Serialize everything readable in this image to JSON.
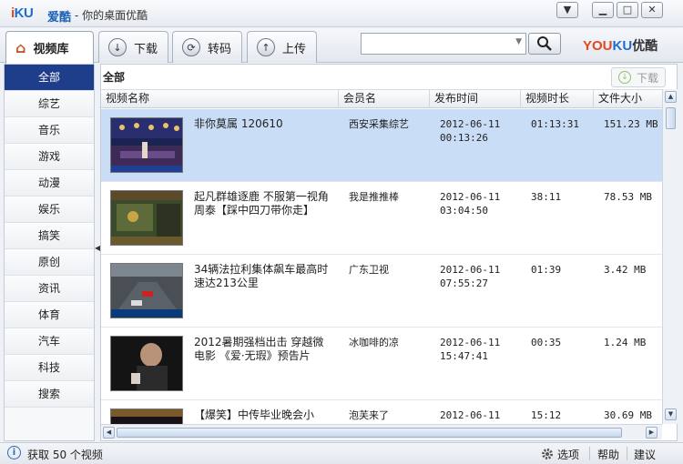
{
  "window": {
    "logo": "iKU",
    "app_name": "爱酷",
    "subtitle": "- 你的桌面优酷",
    "controls": {
      "dropdown": "▼",
      "minimize": "▁",
      "maximize": "□",
      "close": "✕"
    }
  },
  "toolbar": {
    "tabs": [
      {
        "label": "视频库",
        "icon": "home-icon",
        "active": true
      },
      {
        "label": "下载",
        "icon": "download-icon",
        "active": false
      },
      {
        "label": "转码",
        "icon": "convert-icon",
        "active": false
      },
      {
        "label": "上传",
        "icon": "upload-icon",
        "active": false
      }
    ],
    "search": {
      "value": "",
      "placeholder": ""
    },
    "brand": {
      "youku": "YOUKU",
      "cn": "优酷"
    }
  },
  "sidebar": {
    "items": [
      "全部",
      "综艺",
      "音乐",
      "游戏",
      "动漫",
      "娱乐",
      "搞笑",
      "原创",
      "资讯",
      "体育",
      "汽车",
      "科技",
      "搜索"
    ],
    "active_index": 0
  },
  "main": {
    "heading": "全部",
    "download_label": "下载",
    "columns": [
      "视频名称",
      "会员名",
      "发布时间",
      "视频时长",
      "文件大小"
    ],
    "videos": [
      {
        "title": "非你莫属 120610",
        "user": "西安采集综艺",
        "date": "2012-06-11",
        "time": "00:13:26",
        "duration": "01:13:31",
        "size": "151.23 MB",
        "selected": true
      },
      {
        "title": "起凡群雄逐鹿 不服第一视角周泰【踩中四刀带你走】",
        "user": "我是推推棒",
        "date": "2012-06-11",
        "time": "03:04:50",
        "duration": "38:11",
        "size": "78.53 MB",
        "selected": false
      },
      {
        "title": "34辆法拉利集体飙车最高时速达213公里",
        "user": "广东卫视",
        "date": "2012-06-11",
        "time": "07:55:27",
        "duration": "01:39",
        "size": "3.42 MB",
        "selected": false
      },
      {
        "title": "2012暑期强档出击 穿越微电影 《爱·无瑕》预告片",
        "user": "冰咖啡的凉",
        "date": "2012-06-11",
        "time": "15:47:41",
        "duration": "00:35",
        "size": "1.24 MB",
        "selected": false
      },
      {
        "title": "【爆笑】中传毕业晚会小",
        "user": "泡芙来了",
        "date": "2012-06-11",
        "time": "",
        "duration": "15:12",
        "size": "30.69 MB",
        "selected": false
      }
    ]
  },
  "status": {
    "text": "获取 50 个视频",
    "options": "选项",
    "help": "帮助",
    "feedback": "建议"
  }
}
